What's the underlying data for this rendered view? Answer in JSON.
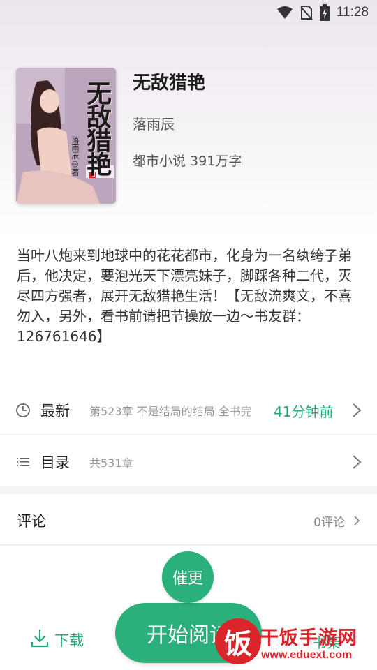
{
  "status_bar": {
    "time": "11:28",
    "icons": [
      "wifi-icon",
      "no-sim-icon",
      "battery-charging-icon"
    ]
  },
  "book": {
    "title": "无敌猎艳",
    "author": "落雨辰",
    "meta": "都市小说 391万字",
    "cover": {
      "title": "无敌猎艳",
      "author_text": "落雨辰◎著"
    },
    "description": "当叶八炮来到地球中的花花都市，化身为一名纨绔子弟后，他决定，要泡光天下漂亮妹子，脚踩各种二代，灭尽四方强者，展开无敌猎艳生活！【无敌流爽文，不喜勿入，另外，看书前请把节操放一边～书友群：126761646】"
  },
  "latest": {
    "icon": "clock-icon",
    "label": "最新",
    "chapter": "第523章 不是结局的结局 全书完",
    "time": "41分钟前"
  },
  "toc": {
    "icon": "list-icon",
    "label": "目录",
    "count": "共531章"
  },
  "comments": {
    "label": "评论",
    "count": "0评论"
  },
  "actions": {
    "urge_label": "催更",
    "read_label": "开始阅读",
    "download_label": "下载",
    "shelf_label": "书架"
  },
  "watermark": {
    "logo_char": "饭",
    "name": "干饭手游网",
    "url": "www.eduext.com"
  },
  "colors": {
    "accent": "#2bb07c",
    "watermark": "#d8262b"
  }
}
